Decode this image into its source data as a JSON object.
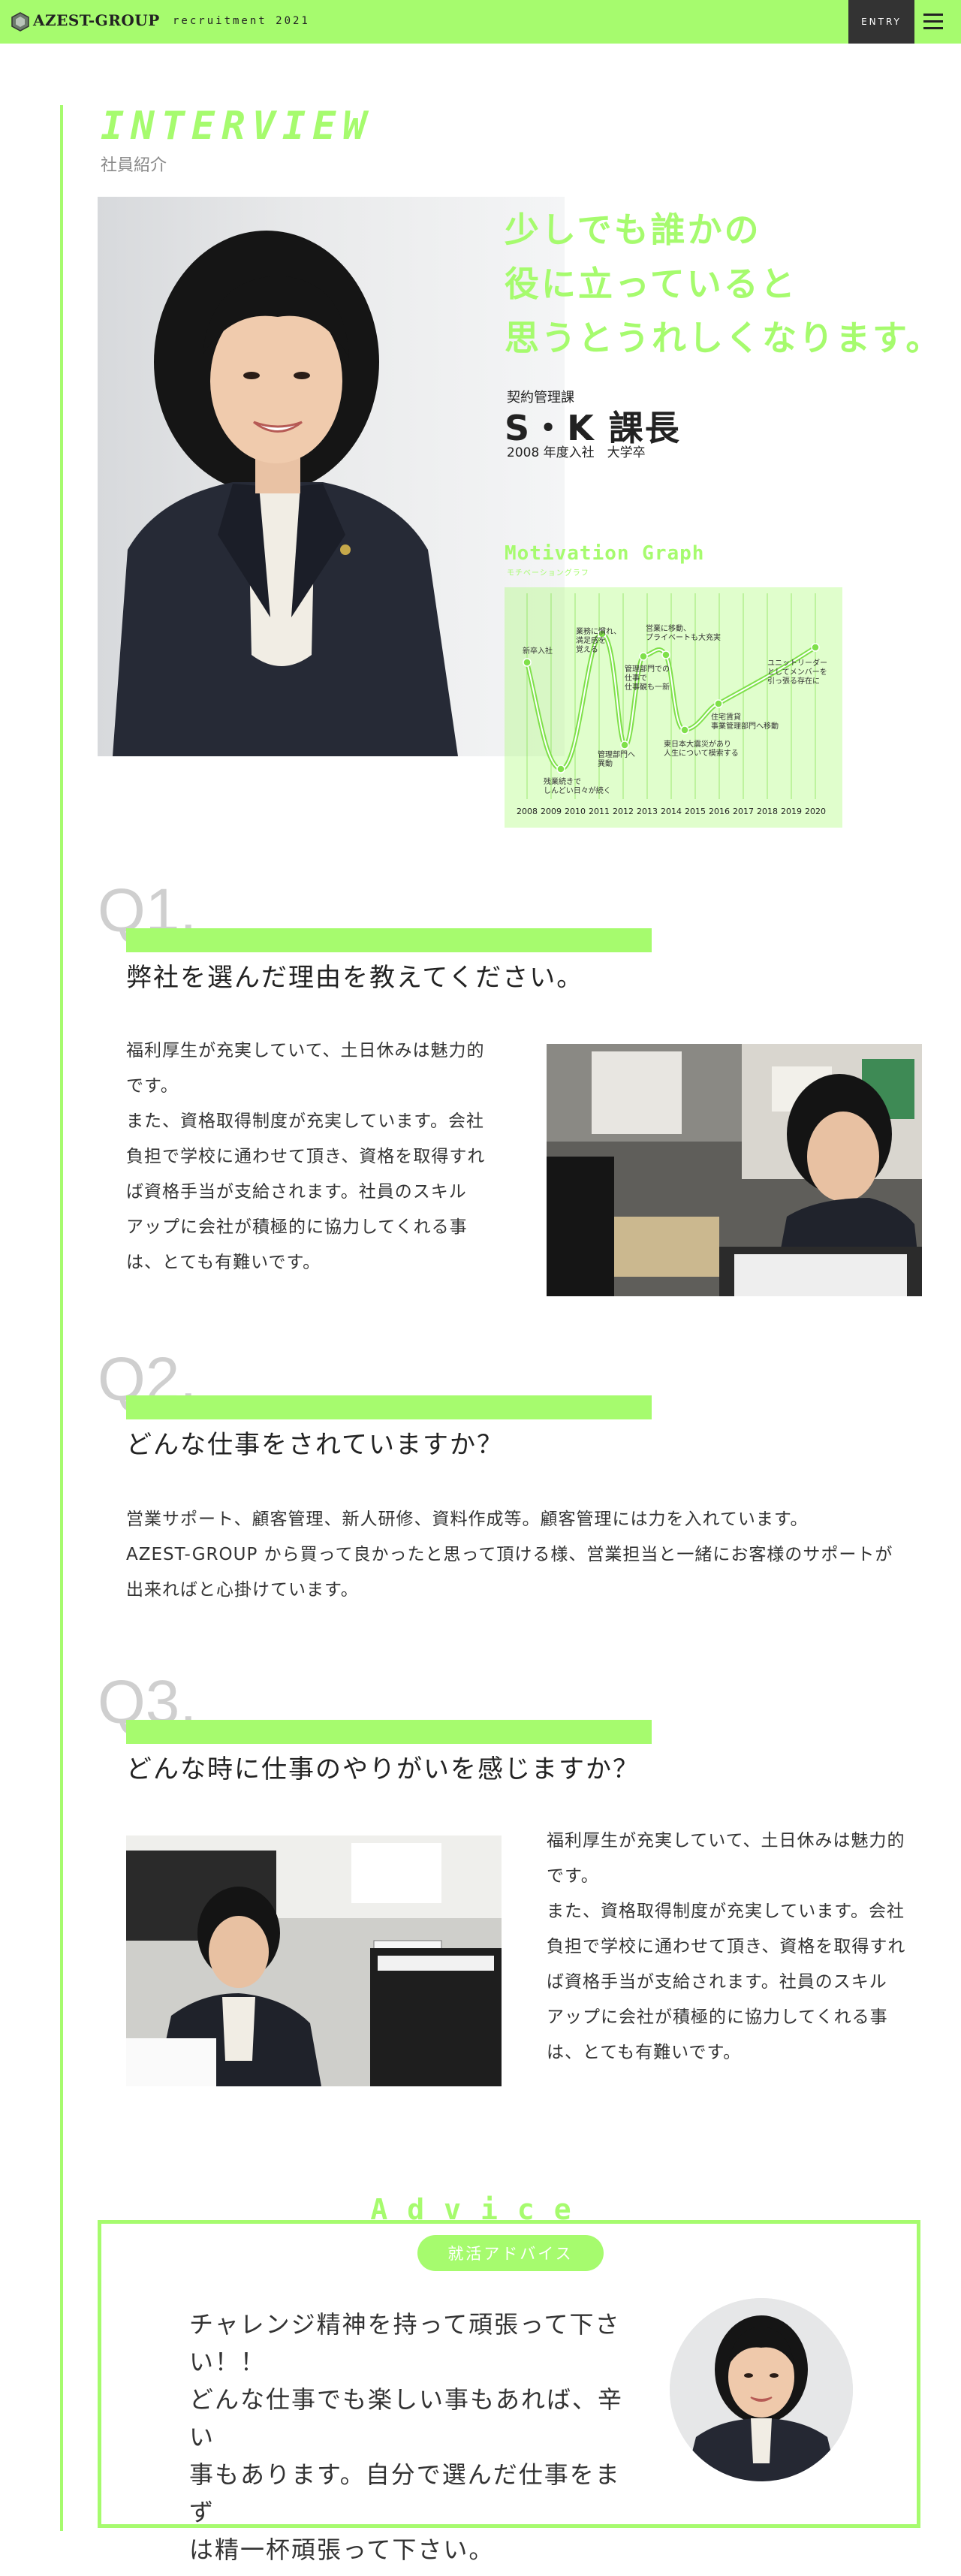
{
  "header": {
    "logo_text": "AZEST-GROUP",
    "subtitle": "recruitment 2021",
    "entry_label": "ENTRY",
    "brand_color": "#a6fb6e",
    "menu_icon": "hamburger-icon"
  },
  "title": {
    "main": "INTERVIEW",
    "sub": "社員紹介"
  },
  "hero": {
    "quote_line1": "少しでも誰かの",
    "quote_line2": "役に立っていると",
    "quote_line3": "思うとうれしくなります。",
    "department": "契約管理課",
    "name": "S・K 課長",
    "joined": "2008 年度入社　大学卒"
  },
  "motivation_graph": {
    "title": "Motivation Graph",
    "subtitle": "モチベーショングラフ",
    "years": [
      "2008",
      "2009",
      "2010",
      "2011",
      "2012",
      "2013",
      "2014",
      "2015",
      "2016",
      "2017",
      "2018",
      "2019",
      "2020"
    ],
    "annotations": {
      "a1": "新卒入社",
      "a2_l1": "残業続きで",
      "a2_l2": "しんどい日々が続く",
      "a3_l1": "業務に慣れ、",
      "a3_l2": "満足感を",
      "a3_l3": "覚える",
      "a4_l1": "管理部門へ",
      "a4_l2": "異動",
      "a5_l1": "管理部門での",
      "a5_l2": "仕事で",
      "a5_l3": "仕事観も一新",
      "a6_l1": "営業に移動、",
      "a6_l2": "プライベートも大充実",
      "a7_l1": "東日本大震災があり",
      "a7_l2": "人生について模索する",
      "a8_l1": "住宅賃貸",
      "a8_l2": "事業管理部門へ移動",
      "a9_l1": "ユニットリーダー",
      "a9_l2": "としてメンバーを",
      "a9_l3": "引っ張る存在に"
    }
  },
  "q1": {
    "num": "Q1.",
    "question": "弊社を選んだ理由を教えてください。",
    "answer_l1": "福利厚生が充実していて、土日休みは魅力的",
    "answer_l2": "です。",
    "answer_l3": "また、資格取得制度が充実しています。会社",
    "answer_l4": "負担で学校に通わせて頂き、資格を取得すれ",
    "answer_l5": "ば資格手当が支給されます。社員のスキル",
    "answer_l6": "アップに会社が積極的に協力してくれる事",
    "answer_l7": "は、とても有難いです。"
  },
  "q2": {
    "num": "Q2.",
    "question": "どんな仕事をされていますか？",
    "answer_l1": "営業サポート、顧客管理、新人研修、資料作成等。顧客管理には力を入れています。",
    "answer_l2": "AZEST-GROUP から買って良かったと思って頂ける様、営業担当と一緒にお客様のサポートが",
    "answer_l3": "出来ればと心掛けています。"
  },
  "q3": {
    "num": "Q3.",
    "question": "どんな時に仕事のやりがいを感じますか？",
    "answer_l1": "福利厚生が充実していて、土日休みは魅力的",
    "answer_l2": "です。",
    "answer_l3": "また、資格取得制度が充実しています。会社",
    "answer_l4": "負担で学校に通わせて頂き、資格を取得すれ",
    "answer_l5": "ば資格手当が支給されます。社員のスキル",
    "answer_l6": "アップに会社が積極的に協力してくれる事",
    "answer_l7": "は、とても有難いです。"
  },
  "advice": {
    "title": "Advice",
    "pill": "就活アドバイス",
    "l1": "チャレンジ精神を持って頑張って下さ",
    "l2": "い！！",
    "l3": "どんな仕事でも楽しい事もあれば、辛い",
    "l4": "事もあります。自分で選んだ仕事をまず",
    "l5": "は精一杯頑張って下さい。"
  }
}
